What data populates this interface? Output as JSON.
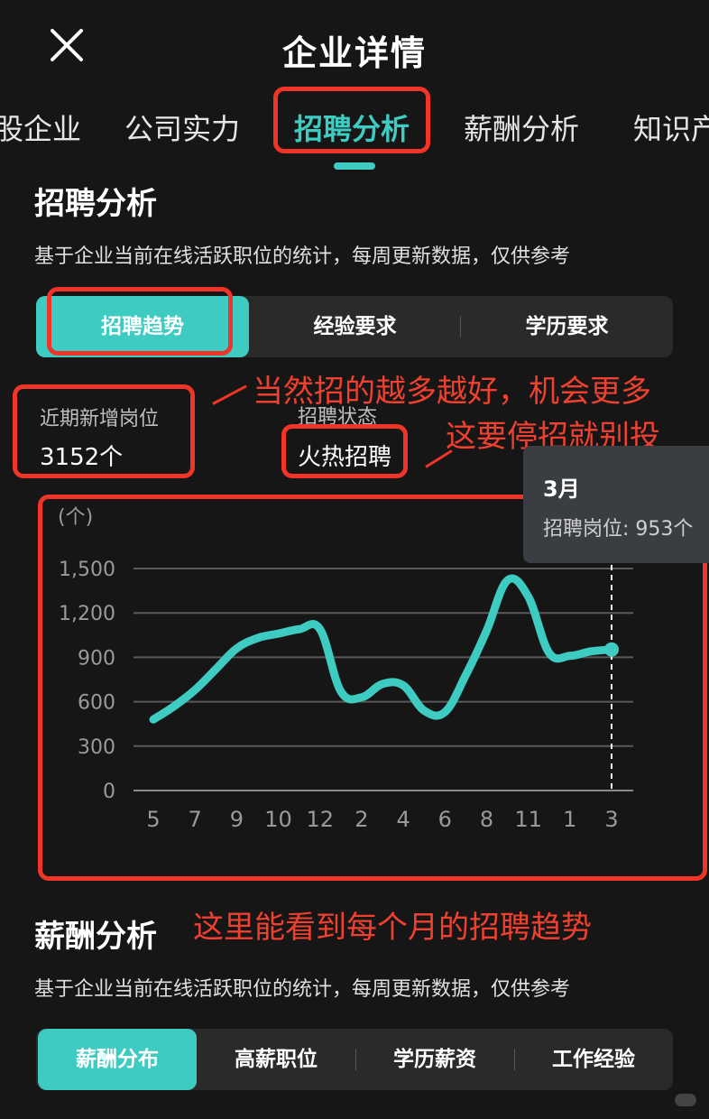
{
  "header": {
    "title": "企业详情"
  },
  "tabs": [
    "股企业",
    "公司实力",
    "招聘分析",
    "薪酬分析",
    "知识产"
  ],
  "recruit": {
    "title": "招聘分析",
    "subtitle": "基于企业当前在线活跃职位的统计，每周更新数据，仅供参考",
    "segments": [
      "招聘趋势",
      "经验要求",
      "学历要求"
    ],
    "stat_label": "近期新增岗位",
    "stat_value": "3152个",
    "status_label": "招聘状态",
    "status_value": "火热招聘"
  },
  "annotations": {
    "note1": "当然招的越多越好，机会更多",
    "note2": "这要停招就别投",
    "note3": "这里能看到每个月的招聘趋势"
  },
  "tooltip": {
    "month": "3月",
    "text": "招聘岗位: 953个"
  },
  "salary": {
    "title": "薪酬分析",
    "subtitle": "基于企业当前在线活跃职位的统计，每周更新数据，仅供参考",
    "segments": [
      "薪酬分布",
      "高薪职位",
      "学历薪资",
      "工作经验"
    ]
  },
  "colors": {
    "accent": "#3ecbc1",
    "annotation": "#f03428",
    "background": "#161616"
  },
  "icons": {
    "close": "close-icon"
  },
  "chart_data": {
    "type": "line",
    "ylabel": "(个)",
    "ylim": [
      0,
      1500
    ],
    "yticks": [
      "0",
      "300",
      "600",
      "900",
      "1,200",
      "1,500"
    ],
    "categories": [
      "5",
      "",
      "7",
      "",
      "9",
      "",
      "10",
      "",
      "12",
      "",
      "2",
      "",
      "4",
      "",
      "6",
      "",
      "8",
      "",
      "11",
      "",
      "1",
      "",
      "3"
    ],
    "x_labels": [
      "5",
      "7",
      "9",
      "10",
      "12",
      "2",
      "4",
      "6",
      "8",
      "11",
      "1",
      "3"
    ],
    "values": [
      480,
      570,
      680,
      820,
      960,
      1030,
      1060,
      1090,
      1090,
      670,
      630,
      720,
      710,
      540,
      530,
      780,
      1080,
      1420,
      1310,
      930,
      910,
      940,
      953
    ],
    "highlight_index": 22,
    "grid": true
  }
}
